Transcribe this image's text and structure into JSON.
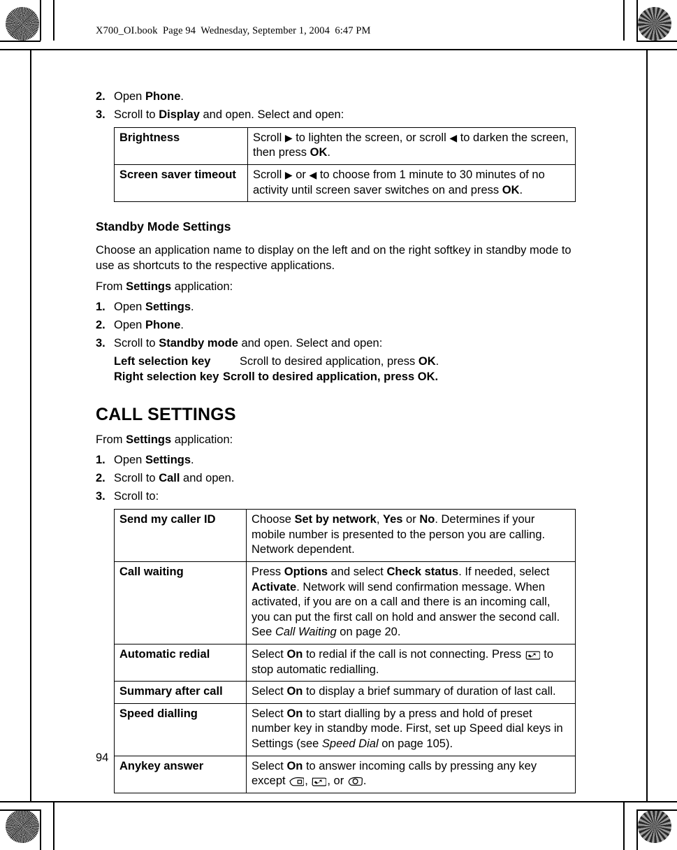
{
  "document": {
    "header": "X700_OI.book  Page 94  Wednesday, September 1, 2004  6:47 PM",
    "page_number": "94"
  },
  "display_steps": {
    "step2": {
      "num": "2.",
      "pre": "Open ",
      "bold": "Phone",
      "post": "."
    },
    "step3": {
      "num": "3.",
      "pre": "Scroll to ",
      "bold": "Display",
      "post": " and open. Select and open:"
    }
  },
  "display_table": {
    "rows": [
      {
        "key": "Brightness",
        "value_parts": [
          {
            "t": "Scroll ",
            "s": "n"
          },
          {
            "t": "▶",
            "s": "arrow"
          },
          {
            "t": " to lighten the screen, or scroll ",
            "s": "n"
          },
          {
            "t": "◀",
            "s": "arrow"
          },
          {
            "t": " to darken the screen, then press ",
            "s": "n"
          },
          {
            "t": "OK",
            "s": "b"
          },
          {
            "t": ".",
            "s": "n"
          }
        ]
      },
      {
        "key": "Screen saver timeout",
        "value_parts": [
          {
            "t": "Scroll ",
            "s": "n"
          },
          {
            "t": "▶",
            "s": "arrow"
          },
          {
            "t": " or ",
            "s": "n"
          },
          {
            "t": "◀",
            "s": "arrow"
          },
          {
            "t": " to choose from 1 minute to 30 minutes of no activity until screen saver switches on and press ",
            "s": "n"
          },
          {
            "t": "OK",
            "s": "b"
          },
          {
            "t": ".",
            "s": "n"
          }
        ]
      }
    ]
  },
  "standby": {
    "heading": "Standby Mode Settings",
    "intro": "Choose an application name to display on the left and on the right softkey in standby mode to use as shortcuts to the respective applications.",
    "from_line": {
      "pre": "From ",
      "bold": "Settings",
      "post": " application:"
    },
    "steps": [
      {
        "num": "1.",
        "pre": "Open ",
        "bold": "Settings",
        "post": "."
      },
      {
        "num": "2.",
        "pre": "Open ",
        "bold": "Phone",
        "post": "."
      },
      {
        "num": "3.",
        "pre": "Scroll to ",
        "bold": "Standby mode",
        "post": " and open. Select and open:"
      }
    ],
    "keys": [
      {
        "key": "Left selection key",
        "pre": "Scroll to desired application, press ",
        "bold": "OK",
        "post": "."
      },
      {
        "key": "Right selection key",
        "pre": "Scroll to desired application, press ",
        "bold": "OK",
        "post": "."
      }
    ]
  },
  "call_settings": {
    "heading": "CALL SETTINGS",
    "from_line": {
      "pre": "From ",
      "bold": "Settings",
      "post": " application:"
    },
    "steps": [
      {
        "num": "1.",
        "pre": "Open ",
        "bold": "Settings",
        "post": "."
      },
      {
        "num": "2.",
        "pre": "Scroll to ",
        "bold": "Call",
        "post": " and open."
      },
      {
        "num": "3.",
        "pre": "Scroll to:",
        "bold": "",
        "post": ""
      }
    ],
    "table": {
      "rows": [
        {
          "key": "Send my caller ID",
          "value_parts": [
            {
              "t": "Choose ",
              "s": "n"
            },
            {
              "t": "Set by network",
              "s": "b"
            },
            {
              "t": ", ",
              "s": "n"
            },
            {
              "t": "Yes",
              "s": "b"
            },
            {
              "t": " or ",
              "s": "n"
            },
            {
              "t": "No",
              "s": "b"
            },
            {
              "t": ". Determines if your mobile number is presented to the person you are calling. Network dependent.",
              "s": "n"
            }
          ]
        },
        {
          "key": "Call waiting",
          "value_parts": [
            {
              "t": "Press ",
              "s": "n"
            },
            {
              "t": "Options",
              "s": "b"
            },
            {
              "t": " and select ",
              "s": "n"
            },
            {
              "t": "Check status",
              "s": "b"
            },
            {
              "t": ". If needed, select ",
              "s": "n"
            },
            {
              "t": "Activate",
              "s": "b"
            },
            {
              "t": ". Network will send confirmation message. When activated, if you are on a call and there is an incoming call, you can put the first call on hold and answer the second call. See ",
              "s": "n"
            },
            {
              "t": "Call Waiting",
              "s": "i"
            },
            {
              "t": " on page 20.",
              "s": "n"
            }
          ]
        },
        {
          "key": "Automatic redial",
          "value_parts": [
            {
              "t": "Select ",
              "s": "n"
            },
            {
              "t": "On",
              "s": "b"
            },
            {
              "t": " to redial if the call is not connecting. Press ",
              "s": "n"
            },
            {
              "t": "end-call-key-icon",
              "s": "icon"
            },
            {
              "t": " to stop automatic redialling.",
              "s": "n"
            }
          ]
        },
        {
          "key": "Summary after call",
          "value_parts": [
            {
              "t": "Select ",
              "s": "n"
            },
            {
              "t": "On",
              "s": "b"
            },
            {
              "t": " to display a brief summary of duration of last call.",
              "s": "n"
            }
          ]
        },
        {
          "key": "Speed dialling",
          "value_parts": [
            {
              "t": "Select ",
              "s": "n"
            },
            {
              "t": "On",
              "s": "b"
            },
            {
              "t": " to start dialling by a press and hold of preset number key in standby mode. First, set up Speed dial keys in Settings (see ",
              "s": "n"
            },
            {
              "t": "Speed Dial",
              "s": "i"
            },
            {
              "t": " on page 105).",
              "s": "n"
            }
          ]
        },
        {
          "key": "Anykey answer",
          "value_parts": [
            {
              "t": "Select ",
              "s": "n"
            },
            {
              "t": "On",
              "s": "b"
            },
            {
              "t": " to answer incoming calls by pressing any key except ",
              "s": "n"
            },
            {
              "t": "softkey-key-icon",
              "s": "icon"
            },
            {
              "t": ", ",
              "s": "n"
            },
            {
              "t": "end-call-key-icon",
              "s": "icon"
            },
            {
              "t": ", or ",
              "s": "n"
            },
            {
              "t": "zero-key-icon",
              "s": "icon"
            },
            {
              "t": ".",
              "s": "n"
            }
          ]
        }
      ]
    }
  }
}
